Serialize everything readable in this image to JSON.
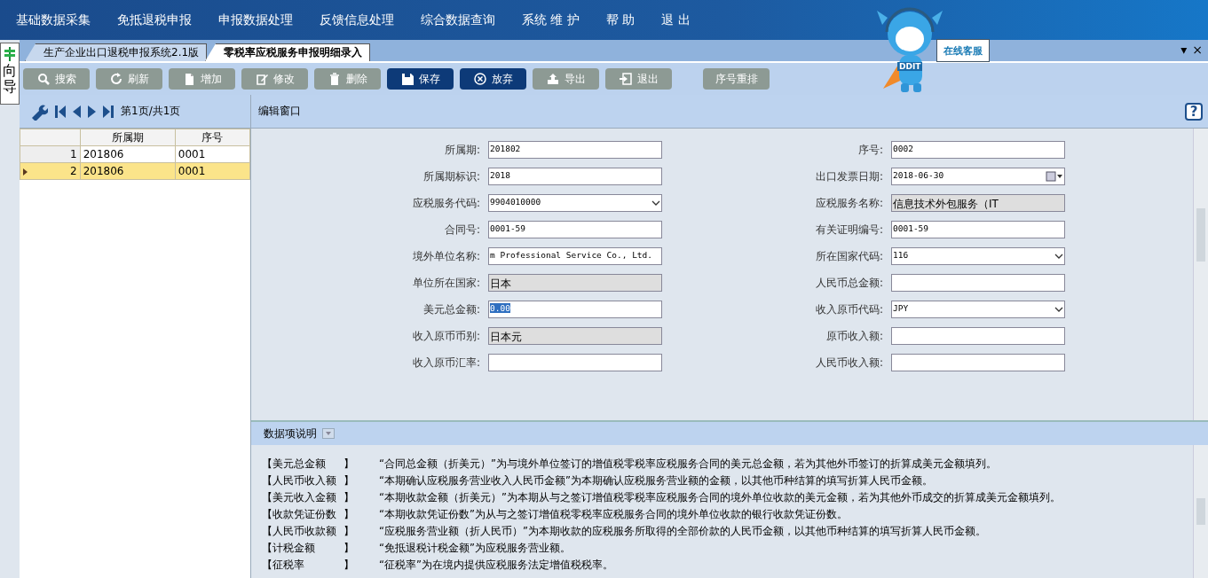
{
  "menu": [
    "基础数据采集",
    "免抵退税申报",
    "申报数据处理",
    "反馈信息处理",
    "综合数据查询",
    "系统 维 护",
    "帮  助",
    "退  出"
  ],
  "mascot": {
    "badge": "DDIT",
    "sign": "在线客服"
  },
  "guide": {
    "label": "向导"
  },
  "tabs": [
    {
      "label": "生产企业出口退税申报系统2.1版",
      "selected": false
    },
    {
      "label": "零税率应税服务申报明细录入",
      "selected": true
    }
  ],
  "tab_controls": [
    "▾",
    "×"
  ],
  "toolbar": [
    {
      "label": "搜索",
      "disabled": true
    },
    {
      "label": "刷新",
      "disabled": true
    },
    {
      "label": "增加",
      "disabled": true
    },
    {
      "label": "修改",
      "disabled": true
    },
    {
      "label": "删除",
      "disabled": true
    },
    {
      "label": "保存",
      "disabled": false
    },
    {
      "label": "放弃",
      "disabled": false
    },
    {
      "label": "导出",
      "disabled": true
    },
    {
      "label": "退出",
      "disabled": true
    },
    {
      "label": "序号重排",
      "disabled": true
    }
  ],
  "pager": {
    "label": "第1页/共1页"
  },
  "grid": {
    "columns": [
      "所属期",
      "序号"
    ],
    "rows": [
      {
        "index": "1",
        "cells": [
          "201806",
          "0001"
        ],
        "selected": false
      },
      {
        "index": "2",
        "cells": [
          "201806",
          "0001"
        ],
        "selected": true
      }
    ]
  },
  "editor": {
    "title": "编辑窗口",
    "help": "?",
    "fields": [
      {
        "label": "所属期:",
        "value": "201802",
        "kind": "text",
        "highlighted": false
      },
      {
        "label": "序号:",
        "value": "0002",
        "kind": "text",
        "highlighted": false
      },
      {
        "label": "所属期标识:",
        "value": "2018",
        "kind": "text",
        "highlighted": false
      },
      {
        "label": "出口发票日期:",
        "value": "2018-06-30",
        "kind": "date",
        "highlighted": false
      },
      {
        "label": "应税服务代码:",
        "value": "9904010000",
        "kind": "select",
        "highlighted": false
      },
      {
        "label": "应税服务名称:",
        "value": "信息技术外包服务（IT",
        "kind": "readonly",
        "highlighted": false
      },
      {
        "label": "合同号:",
        "value": "0001-59",
        "kind": "text",
        "highlighted": false
      },
      {
        "label": "有关证明编号:",
        "value": "0001-59",
        "kind": "text",
        "highlighted": false
      },
      {
        "label": "境外单位名称:",
        "value": "m Professional Service Co., Ltd.",
        "kind": "text",
        "highlighted": false
      },
      {
        "label": "所在国家代码:",
        "value": "116",
        "kind": "select",
        "highlighted": false
      },
      {
        "label": "单位所在国家:",
        "value": "日本",
        "kind": "readonly",
        "highlighted": false
      },
      {
        "label": "人民币总金额:",
        "kind": "text"
      },
      {
        "label": "美元总金额:",
        "value": "0.00",
        "kind": "text",
        "highlighted": true
      },
      {
        "label": "收入原币代码:",
        "value": "JPY",
        "kind": "select",
        "highlighted": false
      },
      {
        "label": "收入原币币别:",
        "value": "日本元",
        "kind": "readonly",
        "highlighted": false
      },
      {
        "label": "原币收入额:",
        "kind": "text"
      },
      {
        "label": "收入原币汇率:",
        "kind": "text"
      },
      {
        "label": "人民币收入额:",
        "kind": "text"
      }
    ]
  },
  "notes": {
    "title": "数据项说明",
    "items": [
      {
        "term": "【美元总金额",
        "close": "】",
        "text": "“合同总金额（折美元）”为与境外单位签订的增值税零税率应税服务合同的美元总金额，若为其他外币签订的折算成美元金额填列。"
      },
      {
        "term": "【人民币收入额",
        "close": "】",
        "text": "“本期确认应税服务营业收入人民币金额”为本期确认应税服务营业额的金额，以其他币种结算的填写折算人民币金额。"
      },
      {
        "term": "【美元收入金额",
        "close": "】",
        "text": "“本期收款金额（折美元）”为本期从与之签订增值税零税率应税服务合同的境外单位收款的美元金额，若为其他外币成交的折算成美元金额填列。"
      },
      {
        "term": "【收款凭证份数",
        "close": "】",
        "text": "“本期收款凭证份数”为从与之签订增值税零税率应税服务合同的境外单位收款的银行收款凭证份数。"
      },
      {
        "term": "【人民币收款额",
        "close": "】",
        "text": "“应税服务营业额（折人民币）”为本期收款的应税服务所取得的全部价款的人民币金额，以其他币种结算的填写折算人民币金额。"
      },
      {
        "term": "【计税金额",
        "close": "】",
        "text": "“免抵退税计税金额”为应税服务营业额。"
      },
      {
        "term": "【征税率",
        "close": "】",
        "text": "“征税率”为在境内提供应税服务法定增值税税率。"
      }
    ]
  }
}
